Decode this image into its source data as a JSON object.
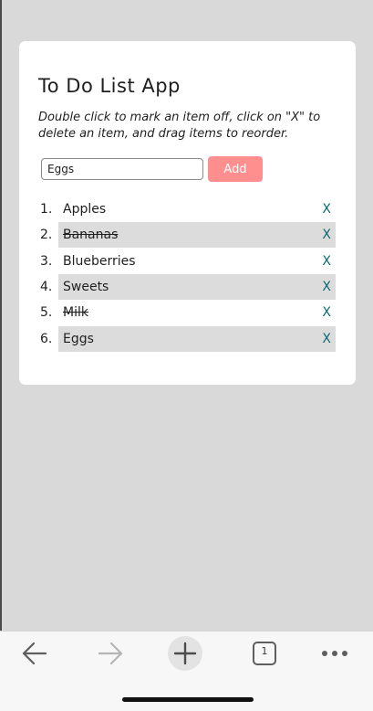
{
  "app": {
    "title": "To Do List App",
    "instructions": "Double click to mark an item off, click on \"X\" to delete an item, and drag items to reorder."
  },
  "form": {
    "input_value": "Eggs",
    "add_label": "Add"
  },
  "items": [
    {
      "number": "1.",
      "text": "Apples",
      "checked": false,
      "delete_label": "X"
    },
    {
      "number": "2.",
      "text": "Bananas",
      "checked": true,
      "delete_label": "X"
    },
    {
      "number": "3.",
      "text": "Blueberries",
      "checked": false,
      "delete_label": "X"
    },
    {
      "number": "4.",
      "text": "Sweets",
      "checked": false,
      "delete_label": "X"
    },
    {
      "number": "5.",
      "text": "Milk",
      "checked": true,
      "delete_label": "X"
    },
    {
      "number": "6.",
      "text": "Eggs",
      "checked": false,
      "delete_label": "X"
    }
  ],
  "browser_toolbar": {
    "tab_count": "1",
    "icons": [
      "back-arrow-icon",
      "forward-arrow-icon",
      "new-tab-plus-icon",
      "tab-switcher-icon",
      "more-options-icon"
    ]
  },
  "colors": {
    "page_background": "#d9d9d9",
    "card_background": "#ffffff",
    "add_button": "#ff8f8f",
    "delete_x": "#0f6773",
    "row_shade": "#dcdcdc"
  }
}
